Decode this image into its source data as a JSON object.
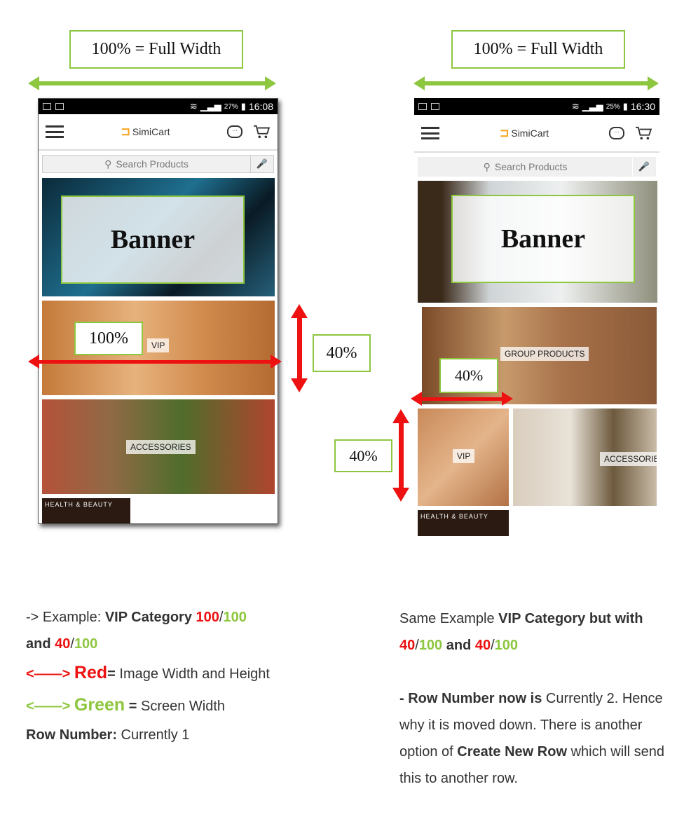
{
  "left_panel": {
    "width_label": "100% = Full Width",
    "phone": {
      "status_bar": {
        "battery_pct": "27%",
        "time": "16:08"
      },
      "app_bar": {
        "logo_text": "SimiCart"
      },
      "search": {
        "placeholder": "Search Products"
      },
      "banner_label": "Banner",
      "tiles": [
        {
          "label": "VIP"
        },
        {
          "label": "ACCESSORIES"
        },
        {
          "label": "HEALTH & BEAUTY"
        }
      ]
    },
    "width_callout": "100%",
    "height_callout": "40%"
  },
  "right_panel": {
    "width_label": "100% = Full Width",
    "phone": {
      "status_bar": {
        "battery_pct": "25%",
        "time": "16:30"
      },
      "app_bar": {
        "logo_text": "SimiCart"
      },
      "search": {
        "placeholder": "Search Products"
      },
      "banner_label": "Banner",
      "tiles": [
        {
          "label": "GROUP PRODUCTS"
        },
        {
          "label": "VIP"
        },
        {
          "label": "ACCESSORIES"
        },
        {
          "label": "HEALTH & BEAUTY"
        }
      ]
    },
    "width_callout": "40%",
    "height_callout": "40%"
  },
  "left_text": {
    "line1_prefix": "-> Example: ",
    "line1_bold": "VIP Category ",
    "line1_red": "100",
    "slash": "/",
    "line1_green": "100",
    "line2_and": "and ",
    "line2_red": "40",
    "line2_green": "100",
    "red_arrow": "<——>",
    "red_word": "Red",
    "red_desc_eq": "=",
    "red_desc": " Image Width and Height",
    "green_arrow": "<——>",
    "green_word": "Green",
    "green_desc_eq": " =",
    "green_desc": " Screen Width",
    "row_label": "Row Number:",
    "row_value": " Currently 1"
  },
  "right_text": {
    "line1_prefix": "Same Example ",
    "line1_bold": "VIP Category but with",
    "v1_red": "40",
    "slash": "/",
    "v1_green": "100",
    "and": " and ",
    "v2_red": "40",
    "v2_green": "100",
    "row_label": "- Row Number now is",
    "row_value": " Currently 2. Hence why it is moved down. There is another option of ",
    "create_new_row": "Create New Row",
    "row_tail": " which will send this to another row."
  }
}
